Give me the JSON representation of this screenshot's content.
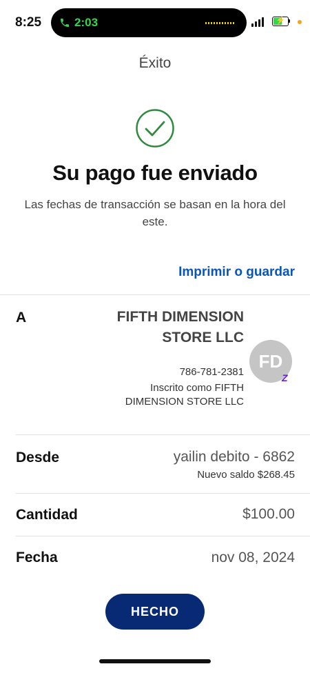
{
  "status_bar": {
    "time": "8:25",
    "call_timer": "2:03"
  },
  "header": {
    "title": "Éxito"
  },
  "confirmation": {
    "headline": "Su pago fue enviado",
    "subtext": "Las fechas de transacción se basan en la hora del este.",
    "print_link": "Imprimir o guardar"
  },
  "details": {
    "to": {
      "label": "A",
      "name": "FIFTH DIMENSION STORE LLC",
      "phone": "786-781-2381",
      "enrolled_as": "Inscrito como FIFTH DIMENSION STORE LLC",
      "avatar_initials": "FD",
      "badge": "Z"
    },
    "from": {
      "label": "Desde",
      "account": "yailin debito - 6862",
      "new_balance": "Nuevo saldo $268.45"
    },
    "amount": {
      "label": "Cantidad",
      "value": "$100.00"
    },
    "date": {
      "label": "Fecha",
      "value": "nov 08, 2024"
    }
  },
  "actions": {
    "done_label": "HECHO"
  },
  "colors": {
    "accent_link": "#0a55b8",
    "button": "#082a74",
    "success": "#2f8a3e"
  }
}
